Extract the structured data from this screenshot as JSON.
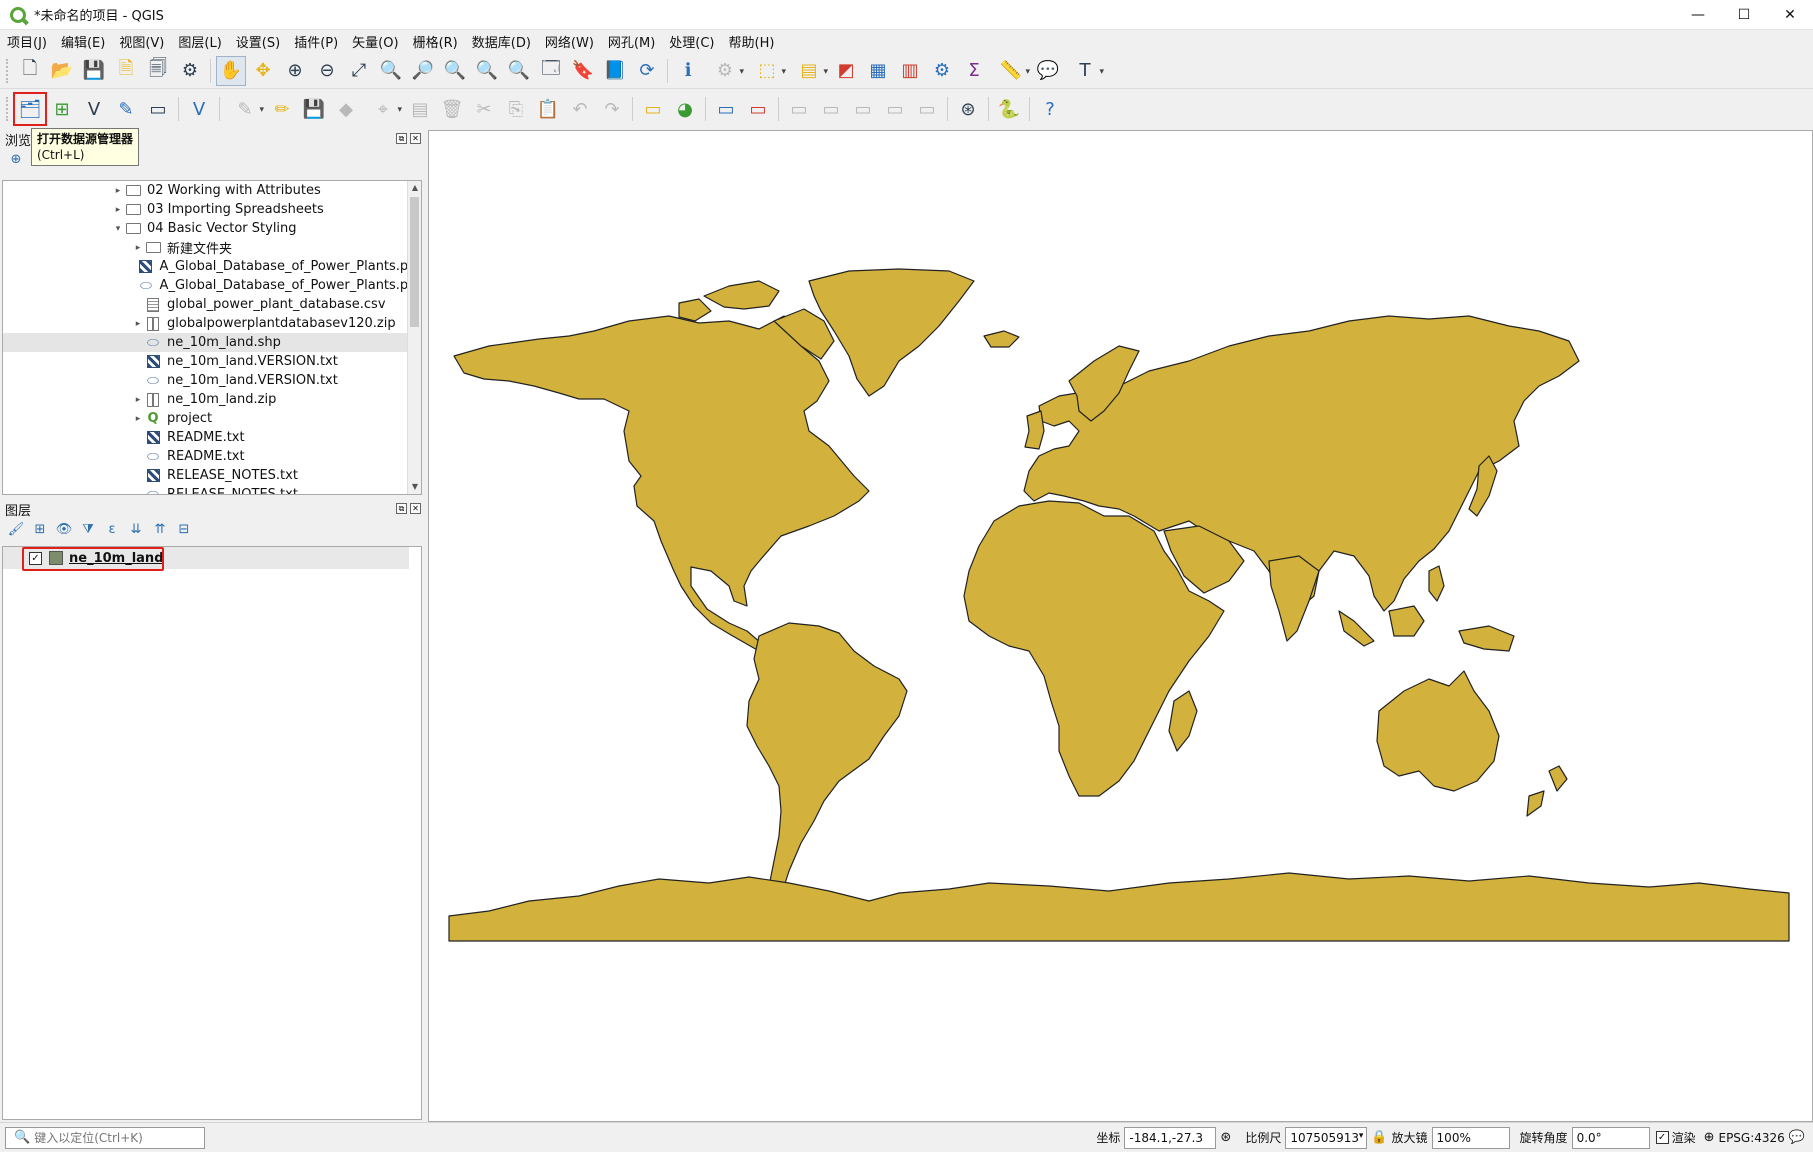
{
  "window": {
    "title": "*未命名的项目 - QGIS",
    "controls": [
      "—",
      "☐",
      "✕"
    ]
  },
  "menu": [
    "项目(J)",
    "编辑(E)",
    "视图(V)",
    "图层(L)",
    "设置(S)",
    "插件(P)",
    "矢量(O)",
    "栅格(R)",
    "数据库(D)",
    "网络(W)",
    "网孔(M)",
    "处理(C)",
    "帮助(H)"
  ],
  "tooltip": {
    "title": "打开数据源管理器",
    "shortcut": "(Ctrl+L)"
  },
  "browser": {
    "title": "浏览",
    "items": [
      {
        "label": "02 Working with Attributes",
        "type": "folder",
        "level": 1,
        "arrow": "▸"
      },
      {
        "label": "03 Importing Spreadsheets",
        "type": "folder",
        "level": 1,
        "arrow": "▸"
      },
      {
        "label": "04 Basic Vector Styling",
        "type": "folder",
        "level": 1,
        "arrow": "▾"
      },
      {
        "label": "新建文件夹",
        "type": "folder",
        "level": 2,
        "arrow": "▸"
      },
      {
        "label": "A_Global_Database_of_Power_Plants.pdf",
        "type": "raster",
        "level": 2,
        "arrow": ""
      },
      {
        "label": "A_Global_Database_of_Power_Plants.pdf",
        "type": "poly",
        "level": 2,
        "arrow": ""
      },
      {
        "label": "global_power_plant_database.csv",
        "type": "csv",
        "level": 2,
        "arrow": ""
      },
      {
        "label": "globalpowerplantdatabasev120.zip",
        "type": "zip",
        "level": 2,
        "arrow": "▸"
      },
      {
        "label": "ne_10m_land.shp",
        "type": "poly",
        "level": 2,
        "arrow": "",
        "selected": true
      },
      {
        "label": "ne_10m_land.VERSION.txt",
        "type": "raster",
        "level": 2,
        "arrow": ""
      },
      {
        "label": "ne_10m_land.VERSION.txt",
        "type": "poly",
        "level": 2,
        "arrow": ""
      },
      {
        "label": "ne_10m_land.zip",
        "type": "zip",
        "level": 2,
        "arrow": "▸"
      },
      {
        "label": "project",
        "type": "qgs",
        "level": 2,
        "arrow": "▸"
      },
      {
        "label": "README.txt",
        "type": "raster",
        "level": 2,
        "arrow": ""
      },
      {
        "label": "README.txt",
        "type": "poly",
        "level": 2,
        "arrow": ""
      },
      {
        "label": "RELEASE_NOTES.txt",
        "type": "raster",
        "level": 2,
        "arrow": ""
      },
      {
        "label": "RELEASE_NOTES.txt",
        "type": "poly",
        "level": 2,
        "arrow": ""
      }
    ]
  },
  "layers": {
    "title": "图层",
    "items": [
      {
        "name": "ne_10m_land",
        "checked": "✓",
        "color": "#7c8c6c"
      }
    ]
  },
  "map": {
    "land_color": "#d2b23c",
    "outline_color": "#222222"
  },
  "statusbar": {
    "locator_placeholder": "键入以定位(Ctrl+K)",
    "coord_label": "坐标",
    "coord_value": "-184.1,-27.3",
    "scale_label": "比例尺",
    "scale_value": "107505913",
    "magnifier_label": "放大镜",
    "magnifier_value": "100%",
    "rotation_label": "旋转角度",
    "rotation_value": "0.0°",
    "render_label": "渲染",
    "crs": "EPSG:4326"
  }
}
